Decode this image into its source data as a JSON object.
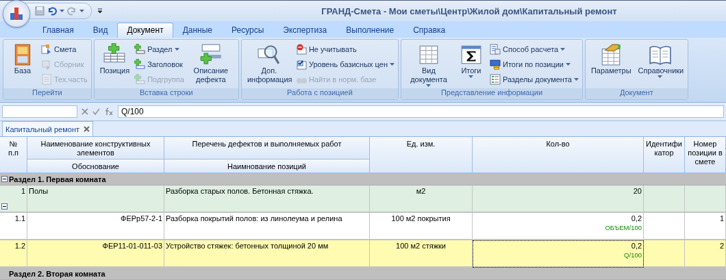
{
  "window": {
    "title": "ГРАНД-Смета - Мои сметы\\Центр\\Жилой дом\\Капитальный ремонт"
  },
  "ribbon_tabs": [
    {
      "label": "Главная",
      "selected": false
    },
    {
      "label": "Вид",
      "selected": false
    },
    {
      "label": "Документ",
      "selected": true
    },
    {
      "label": "Данные",
      "selected": false
    },
    {
      "label": "Ресурсы",
      "selected": false
    },
    {
      "label": "Экспертиза",
      "selected": false
    },
    {
      "label": "Выполнение",
      "selected": false
    },
    {
      "label": "Справка",
      "selected": false
    }
  ],
  "ribbon_groups": [
    {
      "caption": "Перейти",
      "columns": [
        {
          "kind": "large",
          "label": "База",
          "disabled": false,
          "dropdown": false
        },
        {
          "kind": "stack",
          "items": [
            {
              "label": "Смета",
              "disabled": false,
              "dropdown": false
            },
            {
              "label": "Сборник",
              "disabled": true,
              "dropdown": false
            },
            {
              "label": "Тех.часть",
              "disabled": true,
              "dropdown": false
            }
          ]
        }
      ]
    },
    {
      "caption": "Вставка строки",
      "columns": [
        {
          "kind": "large",
          "label": "Позиция",
          "disabled": false,
          "dropdown": false
        },
        {
          "kind": "stack",
          "items": [
            {
              "label": "Раздел",
              "disabled": false,
              "dropdown": true
            },
            {
              "label": "Заголовок",
              "disabled": false,
              "dropdown": false
            },
            {
              "label": "Подгруппа",
              "disabled": true,
              "dropdown": false
            }
          ]
        },
        {
          "kind": "large",
          "label": "Описание дефекта",
          "disabled": false,
          "dropdown": false
        }
      ]
    },
    {
      "caption": "Работа с позицией",
      "columns": [
        {
          "kind": "large",
          "label": "Доп. информация",
          "disabled": false,
          "dropdown": false
        },
        {
          "kind": "stack",
          "items": [
            {
              "label": "Не учитывать",
              "disabled": false,
              "dropdown": false
            },
            {
              "label": "Уровень базисных цен",
              "disabled": false,
              "dropdown": true
            },
            {
              "label": "Найти в норм. базе",
              "disabled": true,
              "dropdown": false
            }
          ]
        }
      ]
    },
    {
      "caption": "Представление информации",
      "columns": [
        {
          "kind": "large",
          "label": "Вид документа",
          "disabled": false,
          "dropdown": true
        },
        {
          "kind": "large",
          "label": "Итоги",
          "disabled": false,
          "dropdown": true
        },
        {
          "kind": "stack",
          "items": [
            {
              "label": "Способ расчета",
              "disabled": false,
              "dropdown": true
            },
            {
              "label": "Итоги по позиции",
              "disabled": false,
              "dropdown": true
            },
            {
              "label": "Разделы документа",
              "disabled": false,
              "dropdown": true
            }
          ]
        }
      ]
    },
    {
      "caption": "Документ",
      "columns": [
        {
          "kind": "large",
          "label": "Параметры",
          "disabled": false,
          "dropdown": false
        },
        {
          "kind": "large",
          "label": "Справочники",
          "disabled": false,
          "dropdown": true
        }
      ]
    }
  ],
  "formula_bar": {
    "value": "Q/100"
  },
  "document_tabs": [
    {
      "label": "Капитальный ремонт",
      "selected": true
    }
  ],
  "table": {
    "columns": [
      {
        "label": "№ п.п"
      },
      {
        "label": "Наименование конструктивных элементов",
        "sublabel": "Обоснование"
      },
      {
        "label": "Перечень дефектов и выполняемых работ",
        "sublabel": "Наимнование позиций"
      },
      {
        "label": "Ед. изм."
      },
      {
        "label": "Кол-во"
      },
      {
        "label": "Идентификатор"
      },
      {
        "label": "Номер позиции в смете"
      }
    ],
    "rows": [
      {
        "kind": "section",
        "title": "Раздел 1. Первая комната",
        "expanded": true
      },
      {
        "kind": "position",
        "num": "1",
        "name": "Полы",
        "work": "Разборка старых полов. Бетонная стяжка.",
        "unit": "м2",
        "qty": "20",
        "expanded": true,
        "selected": false
      },
      {
        "kind": "resource",
        "num": "1.1",
        "justification": "ФЕРр57-2-1",
        "work": "Разборка покрытий полов: из линолеума и релина",
        "unit": "100 м2 покрытия",
        "qty": "0,2",
        "formula": "ОБЪЕМ/100",
        "position_number": "1",
        "selected": false
      },
      {
        "kind": "resource",
        "num": "1.2",
        "justification": "ФЕР11-01-011-03",
        "work": "Устройство стяжек: бетонных толщиной 20 мм",
        "unit": "100 м2 стяжки",
        "qty": "0,2",
        "formula": "Q/100",
        "position_number": "2",
        "selected": true
      },
      {
        "kind": "section",
        "title": "Раздел 2. Вторая комната",
        "expanded": false
      }
    ]
  }
}
